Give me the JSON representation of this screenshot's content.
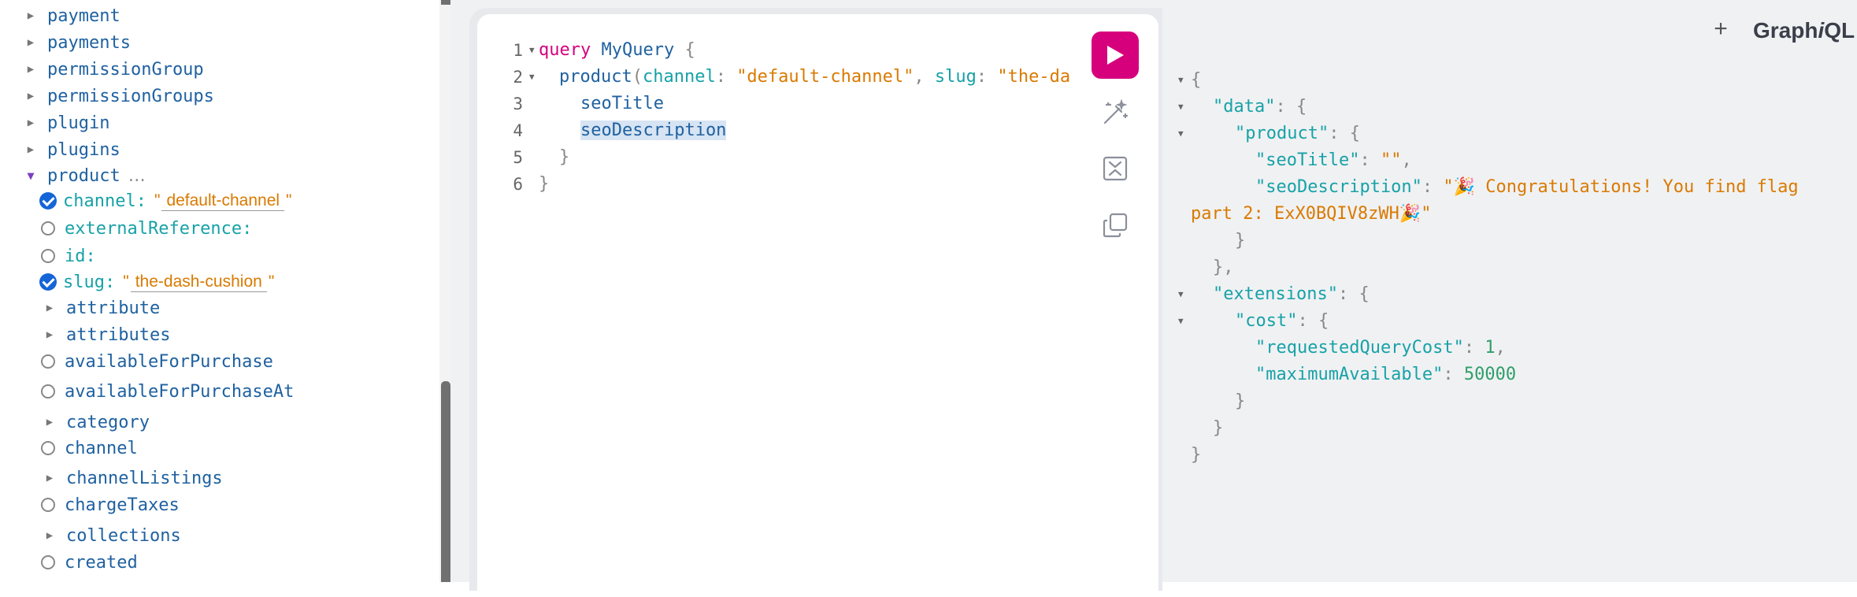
{
  "explorer": {
    "items": [
      {
        "label": "payment"
      },
      {
        "label": "payments"
      },
      {
        "label": "permissionGroup"
      },
      {
        "label": "permissionGroups"
      },
      {
        "label": "plugin"
      },
      {
        "label": "plugins"
      }
    ],
    "product": {
      "label": "product",
      "ellipsis": "…",
      "args": {
        "channel": {
          "label": "channel:",
          "value": "default-channel",
          "checked": true
        },
        "externalReference": {
          "label": "externalReference:",
          "checked": false
        },
        "id": {
          "label": "id:",
          "checked": false
        },
        "slug": {
          "label": "slug:",
          "value": "the-dash-cushion",
          "checked": true
        }
      },
      "fields": [
        {
          "label": "attribute",
          "kind": "object"
        },
        {
          "label": "attributes",
          "kind": "object"
        },
        {
          "label": "availableForPurchase",
          "kind": "scalar"
        },
        {
          "label": "availableForPurchaseAt",
          "kind": "scalar"
        },
        {
          "label": "category",
          "kind": "object"
        },
        {
          "label": "channel",
          "kind": "scalar"
        },
        {
          "label": "channelListings",
          "kind": "object"
        },
        {
          "label": "chargeTaxes",
          "kind": "scalar"
        },
        {
          "label": "collections",
          "kind": "object"
        },
        {
          "label": "created",
          "kind": "scalar"
        }
      ]
    },
    "quote": "\""
  },
  "editor": {
    "line_numbers": [
      "1",
      "2",
      "3",
      "4",
      "5",
      "6"
    ],
    "l1": {
      "kw": "query",
      "name": "MyQuery",
      "brace": "{"
    },
    "l2": {
      "field": "product",
      "open": "(",
      "arg1": "channel",
      "colon1": ":",
      "val1": "\"default-channel\"",
      "comma": ",",
      "arg2": "slug",
      "colon2": ":",
      "val2": "\"the-da"
    },
    "l3": {
      "field": "seoTitle"
    },
    "l4": {
      "field": "seoDescription"
    },
    "l5": {
      "brace": "}"
    },
    "l6": {
      "brace": "}"
    }
  },
  "toolbar": {
    "run_icon": "play-icon",
    "prettify_icon": "magic-wand-icon",
    "merge_icon": "merge-fragments-icon",
    "copy_icon": "copy-icon"
  },
  "result": {
    "open_brace": "{",
    "data_key": "\"data\"",
    "product_key": "\"product\"",
    "seoTitle_key": "\"seoTitle\"",
    "seoTitle_val": "\"\"",
    "seoDescription_key": "\"seoDescription\"",
    "seoDescription_val_1": "\"🎉 Congratulations! You find flag",
    "seoDescription_val_2": "part 2: ExX0BQIV8zWH🎉\"",
    "extensions_key": "\"extensions\"",
    "cost_key": "\"cost\"",
    "requestedQueryCost_key": "\"requestedQueryCost\"",
    "requestedQueryCost_val": "1",
    "maximumAvailable_key": "\"maximumAvailable\"",
    "maximumAvailable_val": "50000",
    "colon": ":",
    "comma": ",",
    "lbrace": "{",
    "rbrace": "}",
    "rbrace_comma": "},"
  },
  "header": {
    "add_tab_label": "+",
    "title_pre": "Graph",
    "title_i": "i",
    "title_post": "QL"
  },
  "colors": {
    "accent": "#d6007d",
    "field": "#1f61a0",
    "arg": "#17a2a7",
    "string": "#d97a00",
    "number": "#2e9e6a",
    "checkbox": "#1565d8"
  }
}
